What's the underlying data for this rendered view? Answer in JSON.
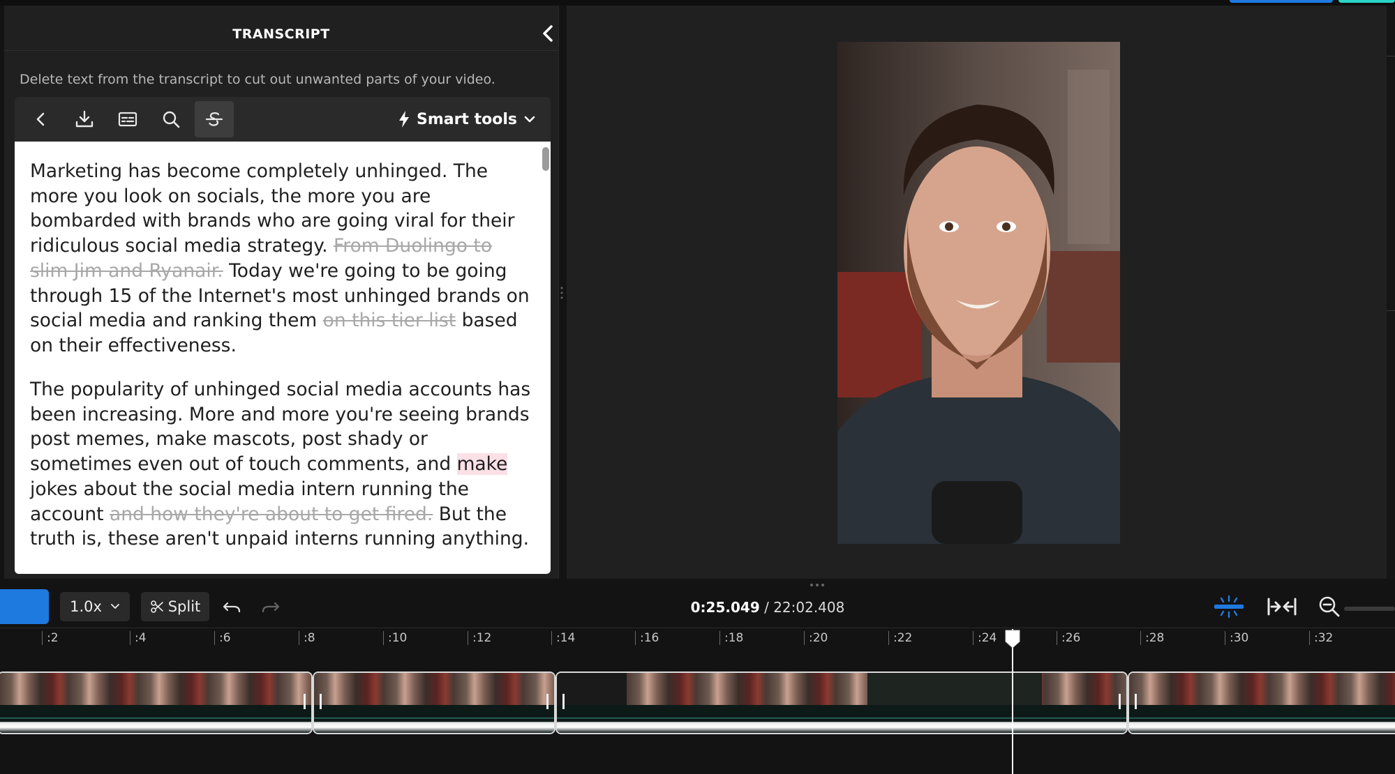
{
  "panel": {
    "title": "TRANSCRIPT",
    "hint": "Delete text from the transcript to cut out unwanted parts of your video.",
    "smart_tools_label": "Smart tools"
  },
  "transcript": {
    "p1": [
      {
        "text": "Marketing has become completely unhinged. The more you look on socials, the more you are bombarded with brands who are going viral for their ridiculous social media strategy. ",
        "deleted": false
      },
      {
        "text": "From Duolingo to slim Jim and Ryanair.",
        "deleted": true
      },
      {
        "text": " Today we're going to be going through 15 of the Internet's most unhinged brands on social media and ranking them ",
        "deleted": false
      },
      {
        "text": "on this tier list",
        "deleted": true
      },
      {
        "text": " based on their effectiveness.",
        "deleted": false
      }
    ],
    "p2": [
      {
        "text": "The popularity of unhinged social media accounts has been increasing. More and more you're seeing brands post memes, make mascots, post shady or sometimes even out of touch comments, and ",
        "deleted": false
      },
      {
        "text": "make",
        "deleted": false,
        "highlight": true
      },
      {
        "text": " jokes about the social media intern running the account ",
        "deleted": false
      },
      {
        "text": "and how they're about to get fired.",
        "deleted": true
      },
      {
        "text": " But the truth is, these aren't unpaid interns running anything.",
        "deleted": false
      }
    ]
  },
  "timeline": {
    "speed": "1.0x",
    "split_label": "Split",
    "current_time": "0:25.049",
    "separator": " / ",
    "total_time": "22:02.408",
    "ticks": [
      ":2",
      ":4",
      ":6",
      ":8",
      ":10",
      ":12",
      ":14",
      ":16",
      ":18",
      ":20",
      ":22",
      ":24",
      ":26",
      ":28",
      ":30",
      ":32"
    ]
  },
  "colors": {
    "accent": "#1f7ae0",
    "teal": "#2ad4c5",
    "deleted_text": "#a8a8a8",
    "highlight": "#fbe0e6"
  },
  "icons": {
    "back": "chevron-left-icon",
    "download": "download-icon",
    "captions": "captions-icon",
    "search": "search-icon",
    "strikethrough": "strikethrough-icon",
    "smart_tools": "lightning-icon"
  }
}
